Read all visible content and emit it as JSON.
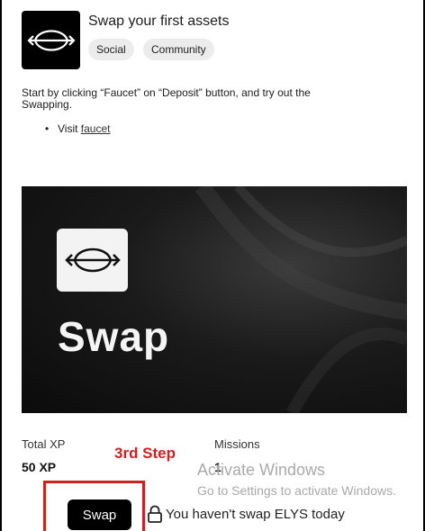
{
  "mission": {
    "title": "Swap your first assets",
    "logo_icon": "swap-arrows-icon",
    "tags": [
      "Social",
      "Community"
    ],
    "description": "Start by clicking “Faucet” on “Deposit” button, and try out the Swapping.",
    "visit_prefix": "Visit",
    "visit_link": "faucet",
    "bullet": "•"
  },
  "banner": {
    "text": "Swap",
    "icon": "swap-arrows-icon"
  },
  "stats": {
    "total_xp_label": "Total XP",
    "total_xp_value": "50 XP",
    "missions_label": "Missions",
    "missions_value": "1"
  },
  "annotation": {
    "step_label": "3rd Step",
    "highlight_color": "#d01f1f"
  },
  "windows_watermark": {
    "title": "Activate Windows",
    "subtitle": "Go to Settings to activate Windows."
  },
  "action": {
    "button_label": "Swap",
    "lock_icon": "lock-icon",
    "status_text": "You haven't swap ELYS today"
  }
}
